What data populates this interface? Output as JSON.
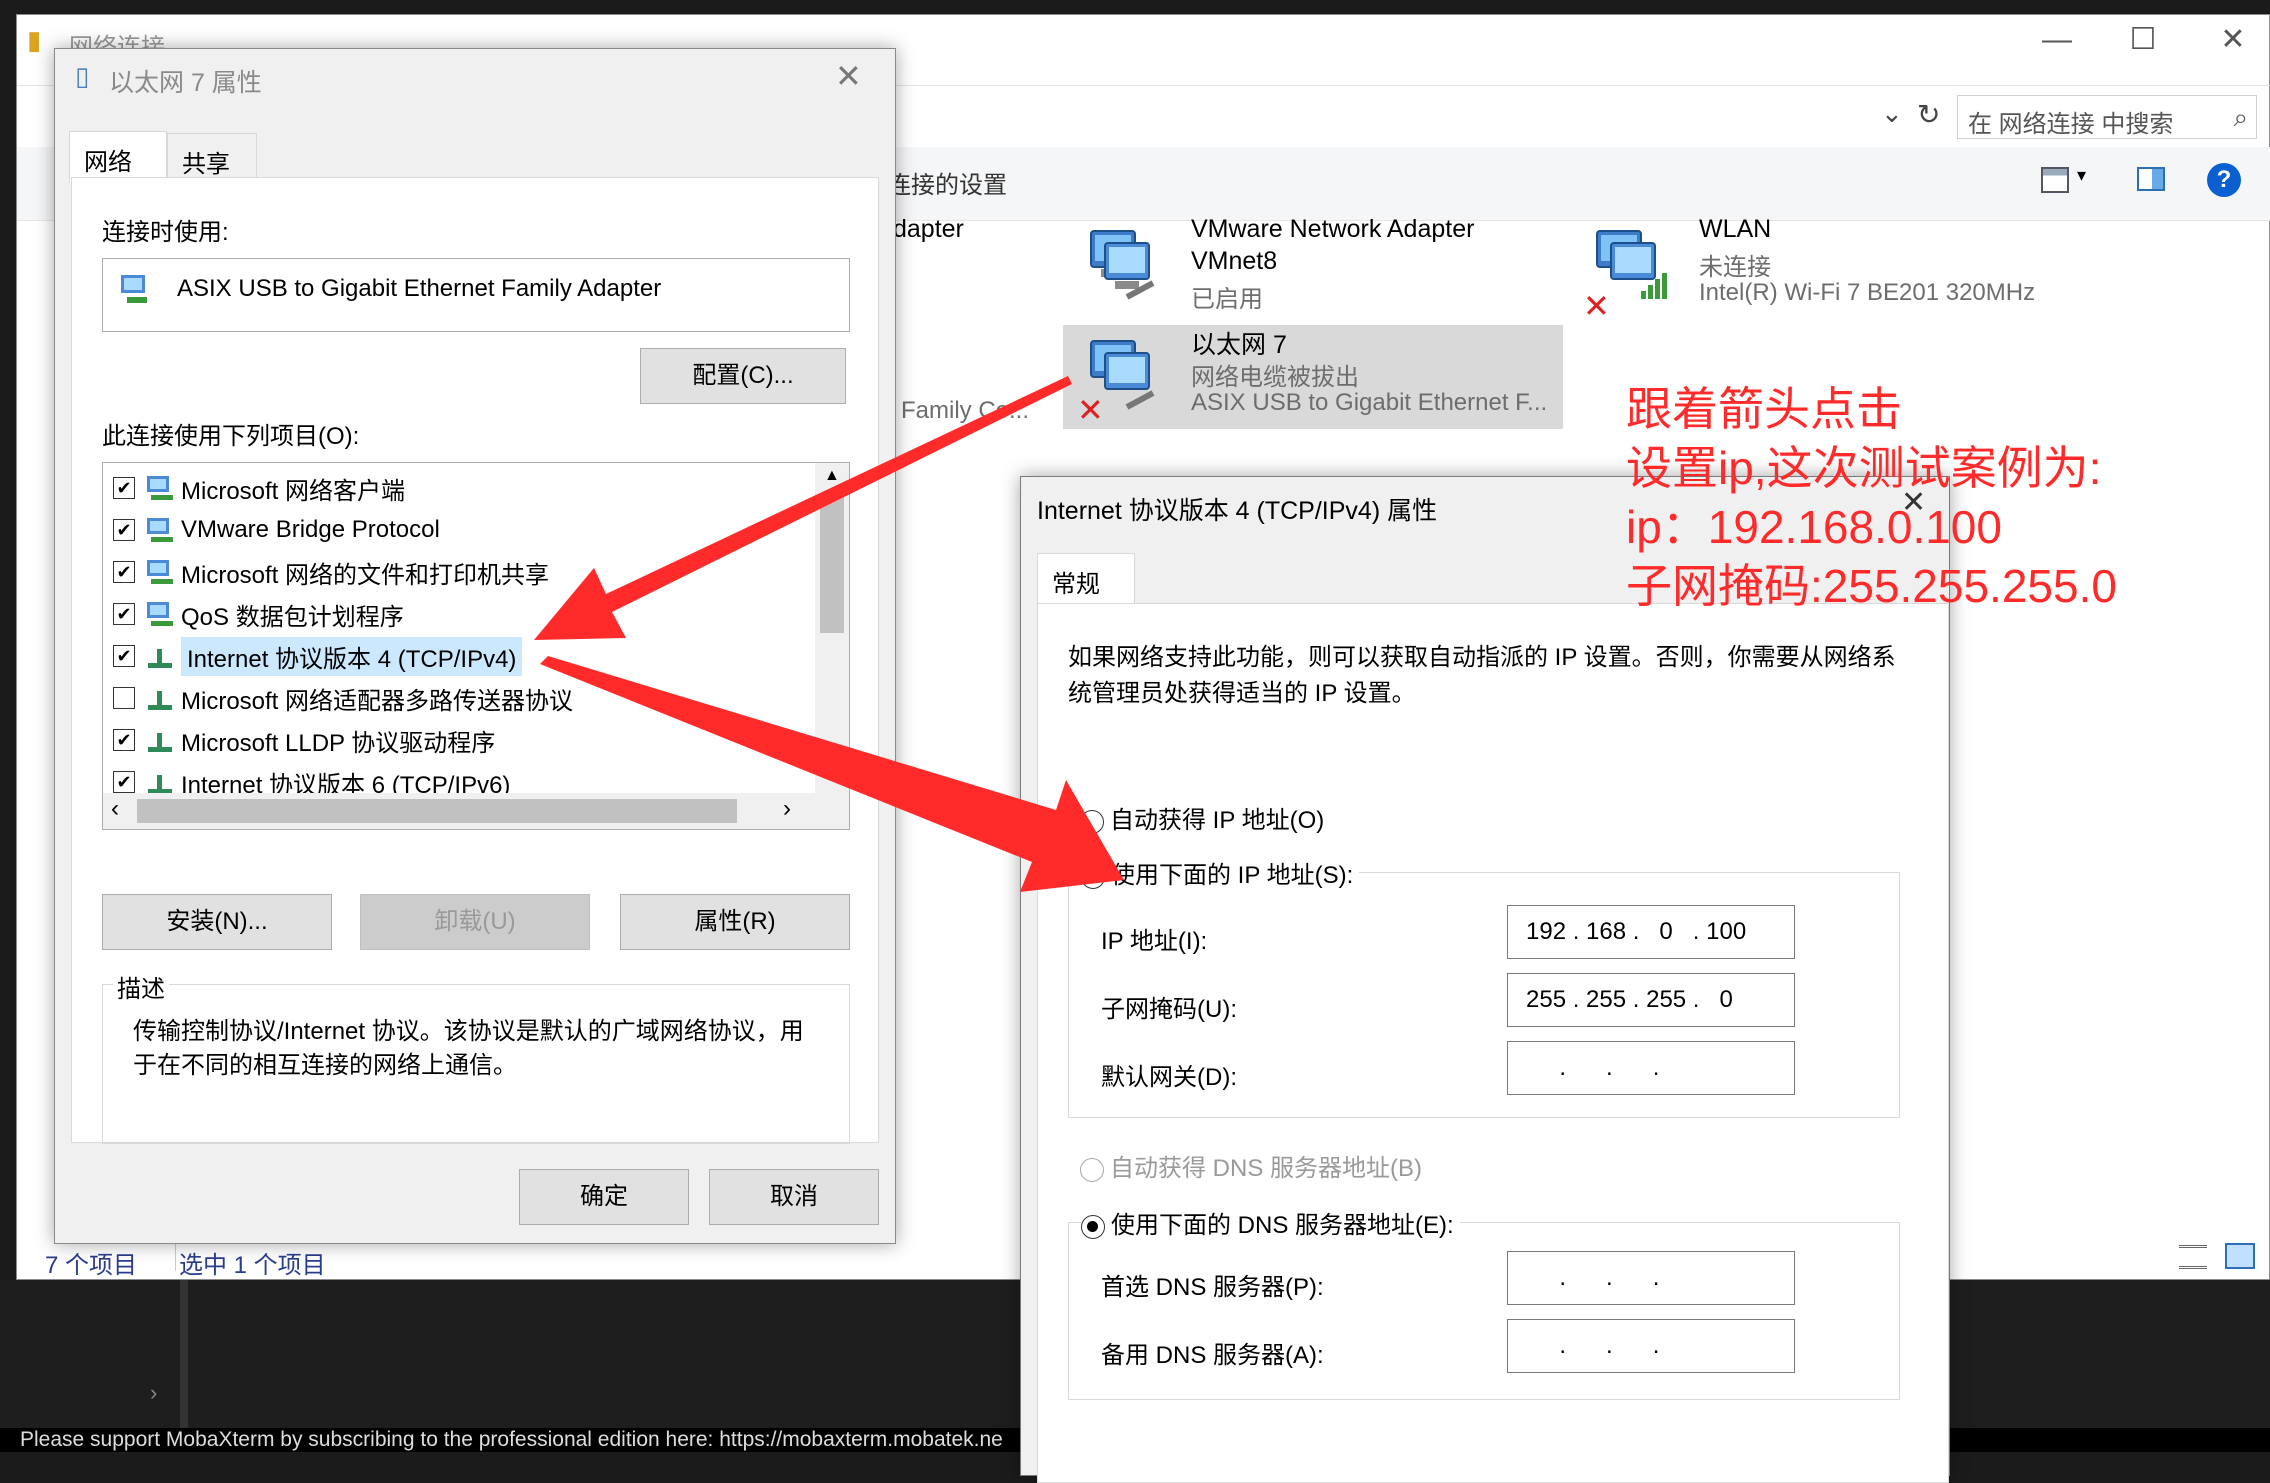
{
  "explorer": {
    "title": "网络连接",
    "search_placeholder": "在 网络连接 中搜索",
    "cmd_text": "连接的设置",
    "status_count": "7 个项目",
    "status_selected": "选中 1 个项目",
    "adapters": [
      {
        "name": "VMware Network Adapter",
        "name2": "VMnet8",
        "status": "已启用",
        "device": ""
      },
      {
        "name": "WLAN",
        "status": "未连接",
        "device": "Intel(R) Wi-Fi 7 BE201 320MHz"
      },
      {
        "name": "以太网 7",
        "status": "网络电缆被拔出",
        "device": "ASIX USB to Gigabit Ethernet F..."
      }
    ],
    "partial_left1": "dapter",
    "partial_left2": "Family Co..."
  },
  "eth_props": {
    "title": "以太网 7 属性",
    "tabs": [
      "网络",
      "共享"
    ],
    "connect_using_label": "连接时使用:",
    "adapter_name": "ASIX USB to Gigabit Ethernet Family Adapter",
    "configure_button": "配置(C)...",
    "items_label": "此连接使用下列项目(O):",
    "items": [
      {
        "label": "Microsoft 网络客户端",
        "checked": true
      },
      {
        "label": "VMware Bridge Protocol",
        "checked": true
      },
      {
        "label": "Microsoft 网络的文件和打印机共享",
        "checked": true
      },
      {
        "label": "QoS 数据包计划程序",
        "checked": true
      },
      {
        "label": "Internet 协议版本 4 (TCP/IPv4)",
        "checked": true
      },
      {
        "label": "Microsoft 网络适配器多路传送器协议",
        "checked": false
      },
      {
        "label": "Microsoft LLDP 协议驱动程序",
        "checked": true
      },
      {
        "label": "Internet 协议版本 6 (TCP/IPv6)",
        "checked": true
      }
    ],
    "install_button": "安装(N)...",
    "uninstall_button": "卸载(U)",
    "properties_button": "属性(R)",
    "description_label": "描述",
    "description_text": "传输控制协议/Internet 协议。该协议是默认的广域网络协议，用于在不同的相互连接的网络上通信。",
    "ok_button": "确定",
    "cancel_button": "取消"
  },
  "ipv4_props": {
    "title": "Internet 协议版本 4 (TCP/IPv4) 属性",
    "tab": "常规",
    "intro": "如果网络支持此功能，则可以获取自动指派的 IP 设置。否则，你需要从网络系统管理员处获得适当的 IP 设置。",
    "auto_ip_label": "自动获得 IP 地址(O)",
    "manual_ip_label": "使用下面的 IP 地址(S):",
    "ip_label": "IP 地址(I):",
    "ip_value": "192 . 168 .   0   . 100",
    "mask_label": "子网掩码(U):",
    "mask_value": "255 . 255 . 255 .   0",
    "gateway_label": "默认网关(D):",
    "gateway_value": "     .      .      .",
    "auto_dns_label": "自动获得 DNS 服务器地址(B)",
    "manual_dns_label": "使用下面的 DNS 服务器地址(E):",
    "dns1_label": "首选 DNS 服务器(P):",
    "dns1_value": "     .      .      .",
    "dns2_label": "备用 DNS 服务器(A):",
    "dns2_value": "     .      .      ."
  },
  "annotation": "跟着箭头点击\n设置ip,这次测试案例为:\nip：192.168.0.100\n子网掩码:255.255.255.0",
  "moba_bar": "Please support MobaXterm by subscribing to the professional edition here:  https://mobaxterm.mobatek.ne",
  "colors": {
    "arrow": "#ff2a2a",
    "accent": "#0078d7",
    "selected": "#cce8ff"
  }
}
